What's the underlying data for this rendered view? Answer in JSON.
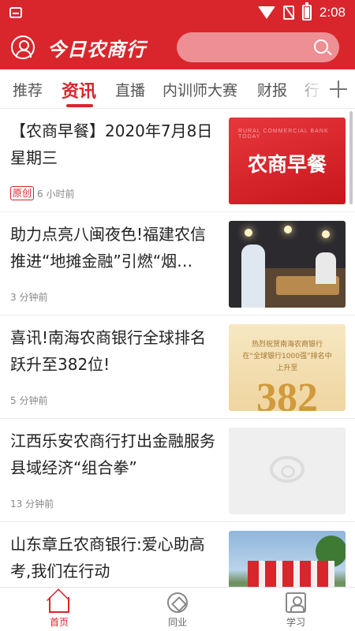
{
  "status_bar": {
    "time": "2:08"
  },
  "header": {
    "logo_text": "今日农商行",
    "search_placeholder": ""
  },
  "tabs": [
    {
      "label": "推荐",
      "active": false
    },
    {
      "label": "资讯",
      "active": true
    },
    {
      "label": "直播",
      "active": false
    },
    {
      "label": "内训师大赛",
      "active": false
    },
    {
      "label": "财报",
      "active": false
    },
    {
      "label": "行",
      "active": false
    }
  ],
  "feed": [
    {
      "title": "【农商早餐】2020年7月8日星期三",
      "badge": "原创",
      "time": "6 小时前",
      "thumb_small": "RURAL COMMERCIAL BANK TODAY",
      "thumb_text": "农商早餐"
    },
    {
      "title": "助力点亮八闽夜色!福建农信推进“地摊金融”引燃“烟…",
      "time": "3 分钟前"
    },
    {
      "title": "喜讯!南海农商银行全球排名跃升至382位!",
      "time": "5 分钟前",
      "thumb_line1": "热烈祝贺南海农商银行",
      "thumb_line2": "在“全球银行1000强”排名中",
      "thumb_line3": "上升至",
      "thumb_number": "382"
    },
    {
      "title": "江西乐安农商行打出金融服务县域经济“组合拳”",
      "time": "13 分钟前"
    },
    {
      "title": "山东章丘农商银行:爱心助高考,我们在行动",
      "time": ""
    }
  ],
  "bottom_nav": [
    {
      "label": "首页",
      "active": true,
      "icon": "home-icon"
    },
    {
      "label": "同业",
      "active": false,
      "icon": "peer-icon"
    },
    {
      "label": "学习",
      "active": false,
      "icon": "study-icon"
    }
  ],
  "colors": {
    "brand": "#d9262c",
    "search_bg": "#ee8f93"
  }
}
